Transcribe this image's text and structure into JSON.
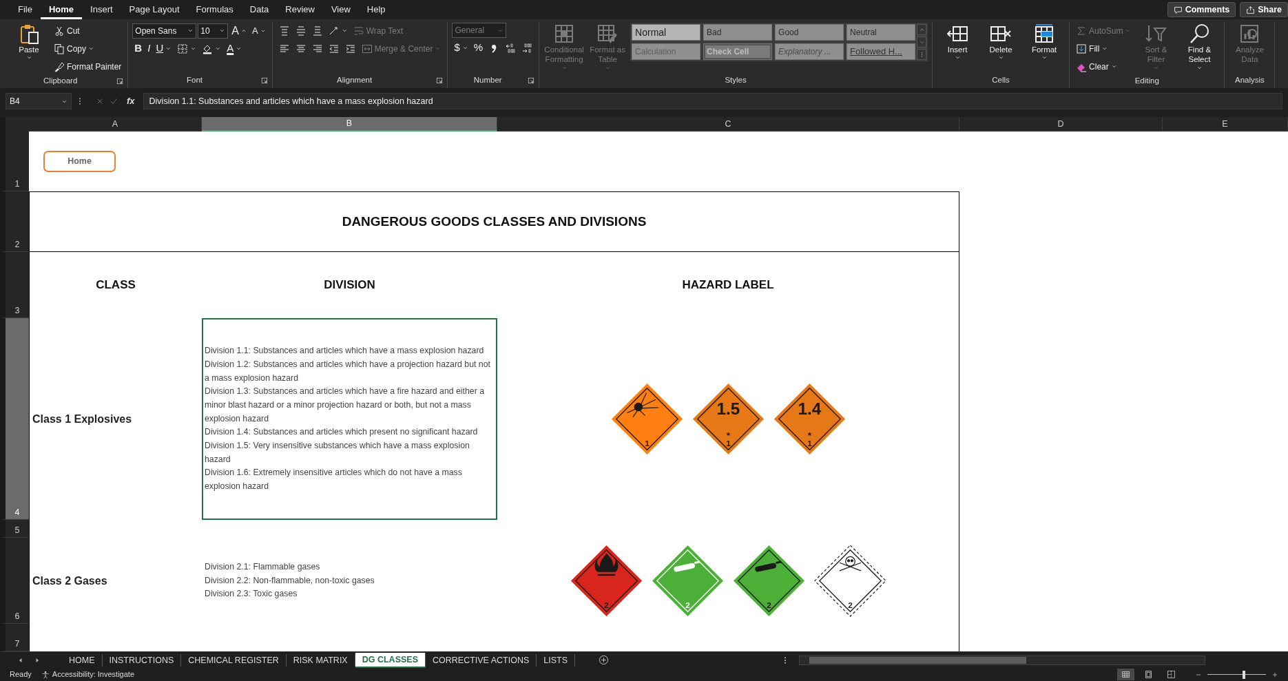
{
  "menu_tabs": [
    {
      "label": "File",
      "selected": false
    },
    {
      "label": "Home",
      "selected": true
    },
    {
      "label": "Insert",
      "selected": false
    },
    {
      "label": "Page Layout",
      "selected": false
    },
    {
      "label": "Formulas",
      "selected": false
    },
    {
      "label": "Data",
      "selected": false
    },
    {
      "label": "Review",
      "selected": false
    },
    {
      "label": "View",
      "selected": false
    },
    {
      "label": "Help",
      "selected": false
    }
  ],
  "top_buttons": [
    "Comments",
    "Share"
  ],
  "ribbon": [
    {
      "name": "Clipboard",
      "launcher": true,
      "columns": [
        {
          "kind": "large",
          "label": "Paste",
          "dropdown": true,
          "disabled": false
        },
        {
          "kind": "stack",
          "lines": [
            {
              "items": [
                {
                  "kind": "button",
                  "label": "Cut",
                  "disabled": false
                }
              ]
            },
            {
              "items": [
                {
                  "kind": "button",
                  "label": "Copy",
                  "dropdown": true,
                  "disabled": false
                }
              ]
            },
            {
              "items": [
                {
                  "kind": "button",
                  "label": "Format Painter",
                  "disabled": false
                }
              ]
            }
          ]
        }
      ]
    },
    {
      "name": "Font",
      "launcher": true,
      "columns": [
        {
          "kind": "stack",
          "lines": [
            {
              "items": [
                {
                  "kind": "field",
                  "value": "Open Sans",
                  "dropdown": true,
                  "disabled": false
                },
                {
                  "kind": "field",
                  "value": "10",
                  "dropdown": true,
                  "disabled": false
                },
                {
                  "kind": "grow",
                  "label": "A",
                  "disabled": false
                },
                {
                  "kind": "shrink",
                  "label": "A",
                  "disabled": false
                }
              ]
            },
            {
              "items": [
                {
                  "kind": "bold",
                  "label": "B",
                  "disabled": false
                },
                {
                  "kind": "italic",
                  "label": "I",
                  "disabled": false
                },
                {
                  "kind": "underline",
                  "label": "U",
                  "dropdown": true,
                  "disabled": false
                },
                {
                  "kind": "icon",
                  "dropdown": true,
                  "disabled": false
                },
                {
                  "kind": "icon",
                  "dropdown": true,
                  "disabled": false
                },
                {
                  "kind": "fontcolor",
                  "label": "A",
                  "dropdown": true,
                  "disabled": false
                }
              ]
            }
          ]
        }
      ]
    },
    {
      "name": "Alignment",
      "launcher": true,
      "columns": [
        {
          "kind": "stack",
          "lines": [
            {
              "items": [
                {
                  "kind": "icon",
                  "disabled": false
                },
                {
                  "kind": "icon",
                  "disabled": false
                },
                {
                  "kind": "icon",
                  "disabled": false
                },
                {
                  "kind": "icon",
                  "dropdown": true,
                  "disabled": false
                },
                {
                  "kind": "button",
                  "label": "Wrap Text",
                  "disabled": true
                }
              ]
            },
            {
              "items": [
                {
                  "kind": "icon",
                  "disabled": false
                },
                {
                  "kind": "icon",
                  "disabled": false
                },
                {
                  "kind": "icon",
                  "disabled": false
                },
                {
                  "kind": "icon",
                  "disabled": false
                },
                {
                  "kind": "icon",
                  "disabled": false
                },
                {
                  "kind": "button",
                  "label": "Merge & Center",
                  "dropdown": true,
                  "disabled": true
                }
              ]
            }
          ]
        }
      ]
    },
    {
      "name": "Number",
      "launcher": true,
      "columns": [
        {
          "kind": "stack",
          "lines": [
            {
              "items": [
                {
                  "kind": "field",
                  "value": "General",
                  "dropdown": true,
                  "disabled": true
                }
              ]
            },
            {
              "items": [
                {
                  "kind": "currency",
                  "label": "$",
                  "dropdown": true,
                  "disabled": false
                },
                {
                  "kind": "percent",
                  "label": "%",
                  "disabled": false
                },
                {
                  "kind": "icon",
                  "disabled": false
                },
                {
                  "kind": "icon",
                  "disabled": false
                },
                {
                  "kind": "icon",
                  "disabled": false
                }
              ]
            }
          ]
        }
      ]
    },
    {
      "name": "Styles",
      "columns": [
        {
          "kind": "large",
          "label": "Conditional Formatting",
          "dropdown": true,
          "disabled": true
        },
        {
          "kind": "large",
          "label": "Format as Table",
          "dropdown": true,
          "disabled": true
        },
        {
          "kind": "gallery",
          "styles": [
            {
              "label": "Normal",
              "kind": "normal"
            },
            {
              "label": "Bad",
              "kind": "bad"
            },
            {
              "label": "Good",
              "kind": "good"
            },
            {
              "label": "Neutral",
              "kind": "neutral"
            },
            {
              "label": "Calculation",
              "kind": "calculation"
            },
            {
              "label": "Check Cell",
              "kind": "check"
            },
            {
              "label": "Explanatory ...",
              "kind": "explanatory"
            },
            {
              "label": "Followed H...",
              "kind": "followed"
            }
          ]
        }
      ]
    },
    {
      "name": "Cells",
      "columns": [
        {
          "kind": "large",
          "label": "Insert",
          "dropdown": true,
          "disabled": false
        },
        {
          "kind": "large",
          "label": "Delete",
          "dropdown": true,
          "disabled": false
        },
        {
          "kind": "large",
          "label": "Format",
          "dropdown": true,
          "disabled": false
        }
      ]
    },
    {
      "name": "Editing",
      "columns": [
        {
          "kind": "stack",
          "lines": [
            {
              "items": [
                {
                  "kind": "button",
                  "label": "AutoSum",
                  "dropdown": true,
                  "disabled": true
                }
              ]
            },
            {
              "items": [
                {
                  "kind": "button",
                  "label": "Fill",
                  "dropdown": true,
                  "disabled": false
                }
              ]
            },
            {
              "items": [
                {
                  "kind": "button",
                  "label": "Clear",
                  "dropdown": true,
                  "disabled": false
                }
              ]
            }
          ]
        },
        {
          "kind": "large",
          "label": "Sort & Filter",
          "dropdown": true,
          "disabled": true
        },
        {
          "kind": "large",
          "label": "Find & Select",
          "dropdown": true,
          "disabled": false
        }
      ]
    },
    {
      "name": "Analysis",
      "columns": [
        {
          "kind": "large",
          "label": "Analyze Data",
          "disabled": true
        }
      ]
    }
  ],
  "formula_bar": {
    "name_box": "B4",
    "fx": "fx",
    "formula": "Division 1.1: Substances and articles which have a mass explosion hazard"
  },
  "sheet": {
    "columns": [
      {
        "label": "A",
        "selected": false
      },
      {
        "label": "B",
        "selected": true
      },
      {
        "label": "C",
        "selected": false
      },
      {
        "label": "D",
        "selected": false
      },
      {
        "label": "E",
        "selected": false
      }
    ],
    "rows": [
      {
        "label": "1",
        "selected": false
      },
      {
        "label": "2",
        "selected": false
      },
      {
        "label": "3",
        "selected": false
      },
      {
        "label": "4",
        "selected": true
      },
      {
        "label": "5",
        "selected": false
      },
      {
        "label": "6",
        "selected": false
      },
      {
        "label": "7",
        "selected": false
      }
    ],
    "home_button": "Home",
    "title": "DANGEROUS GOODS CLASSES AND DIVISIONS",
    "column_titles": [
      "CLASS",
      "DIVISION",
      "HAZARD LABEL"
    ],
    "classes": [
      {
        "name": "Class 1 Explosives",
        "selected": true,
        "divisions": [
          "Division 1.1: Substances and articles which have a mass explosion hazard",
          "Division 1.2: Substances and articles which have a projection hazard but not a mass explosion hazard",
          "Division 1.3: Substances and articles which have a fire hazard and either a minor blast hazard or a minor projection hazard or both, but not a mass explosion hazard",
          "Division 1.4: Substances and articles which present no significant hazard",
          "Division 1.5: Very insensitive substances which have a mass explosion hazard",
          "Division 1.6: Extremely insensitive articles which do not have a mass explosion hazard"
        ],
        "labels": [
          {
            "kind": "explosive",
            "color": "#ff8010",
            "number": "1"
          },
          {
            "kind": "division",
            "color": "#e67817",
            "division": "1.5",
            "compat": "*",
            "number": "1"
          },
          {
            "kind": "division",
            "color": "#e67817",
            "division": "1.4",
            "compat": "*",
            "number": "1"
          }
        ]
      },
      {
        "name": "Class 2 Gases",
        "selected": false,
        "divisions": [
          "Division 2.1: Flammable gases",
          "Division 2.2: Non-flammable, non-toxic gases",
          "Division 2.3: Toxic gases"
        ],
        "labels": [
          {
            "kind": "flammable",
            "color": "#d9261c",
            "number": "2"
          },
          {
            "kind": "gas_cylinder_light",
            "color": "#4caf37",
            "number": "2"
          },
          {
            "kind": "gas_cylinder",
            "color": "#4caf37",
            "number": "2"
          },
          {
            "kind": "toxic",
            "number": "2"
          }
        ]
      }
    ]
  },
  "sheet_tabs": [
    {
      "label": "HOME",
      "selected": false
    },
    {
      "label": "INSTRUCTIONS",
      "selected": false
    },
    {
      "label": "CHEMICAL REGISTER",
      "selected": false
    },
    {
      "label": "RISK MATRIX",
      "selected": false
    },
    {
      "label": "DG CLASSES",
      "selected": true
    },
    {
      "label": "CORRECTIVE ACTIONS",
      "selected": false
    },
    {
      "label": "LISTS",
      "selected": false
    }
  ],
  "status_bar": {
    "status": "Ready",
    "accessibility": "Accessibility: Investigate",
    "views": [
      {
        "selected": true
      },
      {
        "selected": false
      },
      {
        "selected": false
      }
    ],
    "zoom": {
      "level": 0.62
    }
  }
}
